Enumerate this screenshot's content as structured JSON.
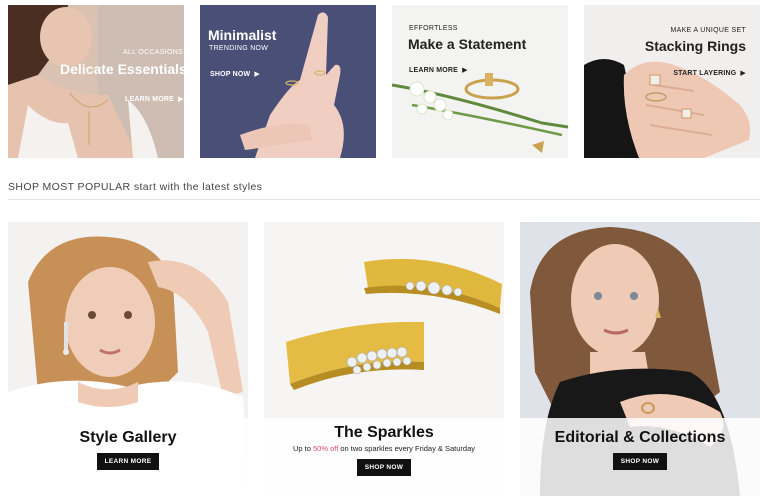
{
  "promos": [
    {
      "kicker": "All occasions",
      "title": "Delicate Essentials",
      "cta": "Learn more"
    },
    {
      "title": "Minimalist",
      "kicker": "Trending now",
      "cta": "Shop now"
    },
    {
      "kicker": "Effortless",
      "title": "Make a Statement",
      "cta": "Learn more"
    },
    {
      "kicker": "Make a unique set",
      "title": "Stacking Rings",
      "cta": "Start layering"
    }
  ],
  "section": {
    "heading": "SHOP MOST POPULAR start with the latest styles"
  },
  "cards": [
    {
      "title": "Style Gallery",
      "button": "Learn more"
    },
    {
      "title": "The Sparkles",
      "sub_pre": "Up to ",
      "sub_highlight": "50% off",
      "sub_post": " on two sparkles every Friday & Saturday",
      "button": "Shop now"
    },
    {
      "title": "Editorial & Collections",
      "button": "Shop now"
    }
  ],
  "icons": {
    "arrow": "play-arrow-icon"
  },
  "colors": {
    "highlight": "#d9486b",
    "button_bg": "#111111"
  }
}
